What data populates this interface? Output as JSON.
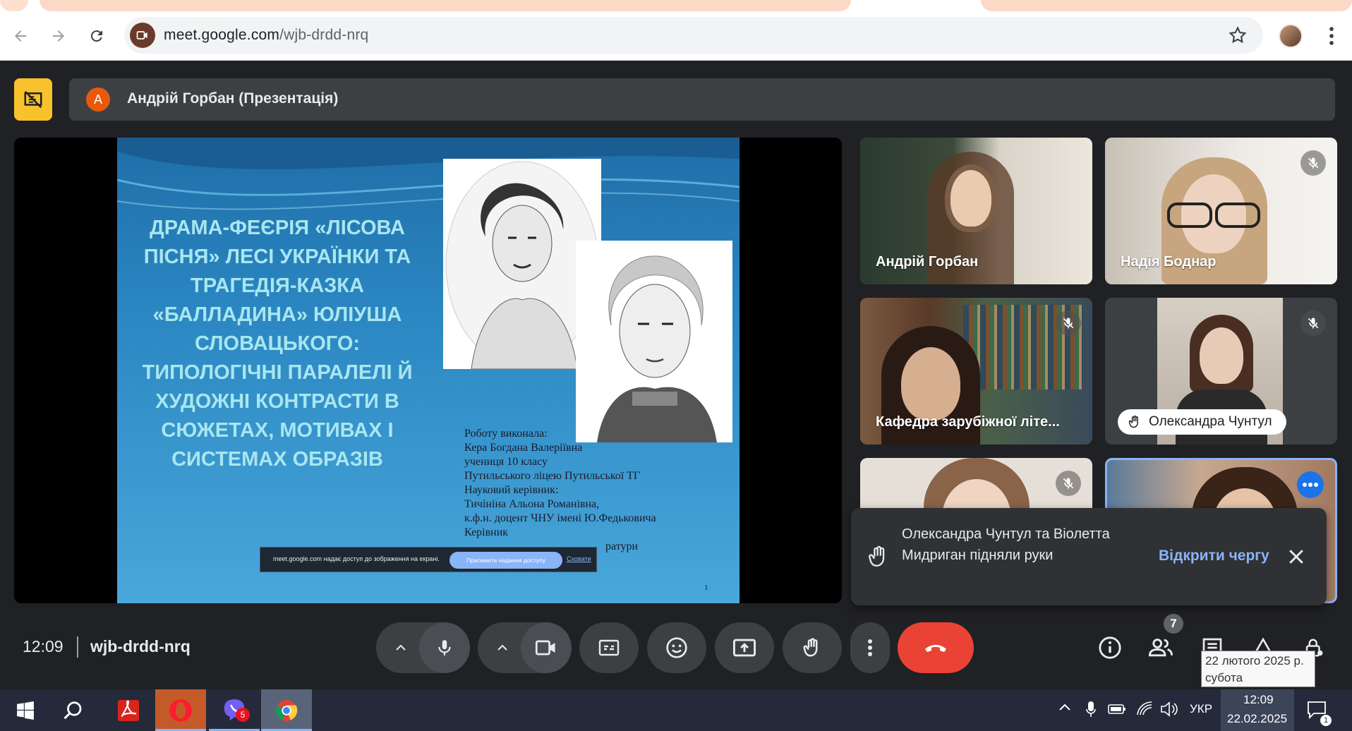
{
  "browser": {
    "url_domain": "meet.google.com",
    "url_path": "/wjb-drdd-nrq"
  },
  "meet": {
    "presenter_initial": "А",
    "presenter_label": "Андрій Горбан (Презентація)",
    "slide": {
      "title": "Драма-феєрія «Лісова пісня» Лесі Українки та трагедія-казка «Балладина» Юліуша Словацького: типологічні паралелі й художні контрасти в сюжетах, мотивах і системах образів",
      "info_lines": [
        "Роботу виконала:",
        "Кера Богдана Валеріївна",
        "учениця 10 класу",
        "Путильського ліцею Путильської ТГ",
        "Науковий керівник:",
        "Тичініна Альона Романівна,",
        "к.ф.н. доцент ЧНУ імені Ю.Федьковича",
        "Керівник"
      ],
      "info_tail_1": "ратури",
      "info_tail_2": "Путильського ліцею",
      "page_number": "1",
      "share_message": "meet.google.com надає доступ до зображення на екрані.",
      "share_stop": "Припинити надання доступу",
      "share_hide": "Сховати"
    },
    "participants": [
      {
        "name": "Андрій Горбан",
        "muted": false
      },
      {
        "name": "Надія Боднар",
        "muted": true
      },
      {
        "name": "Кафедра зарубіжної літе...",
        "muted": true
      },
      {
        "name": "Олександра Чунтул",
        "muted": true,
        "hand_raised": true
      },
      {
        "name": "",
        "muted": true
      },
      {
        "name": "",
        "muted": false,
        "active": true
      }
    ],
    "toast": {
      "message": "Олександра Чунтул та Віолетта Мидриган підняли руки",
      "action": "Відкрити чергу"
    },
    "time": "12:09",
    "meeting_code": "wjb-drdd-nrq",
    "people_count": "7"
  },
  "tooltip": {
    "line1": "22 лютого 2025 р.",
    "line2": "субота"
  },
  "taskbar": {
    "language": "УКР",
    "time": "12:09",
    "date": "22.02.2025",
    "viber_badge": "5",
    "notifications": "1"
  },
  "colors": {
    "meet_bg": "#202124",
    "end_call": "#ea4335",
    "accent_blue": "#8ab4f8",
    "present_yellow": "#f8c22c"
  }
}
